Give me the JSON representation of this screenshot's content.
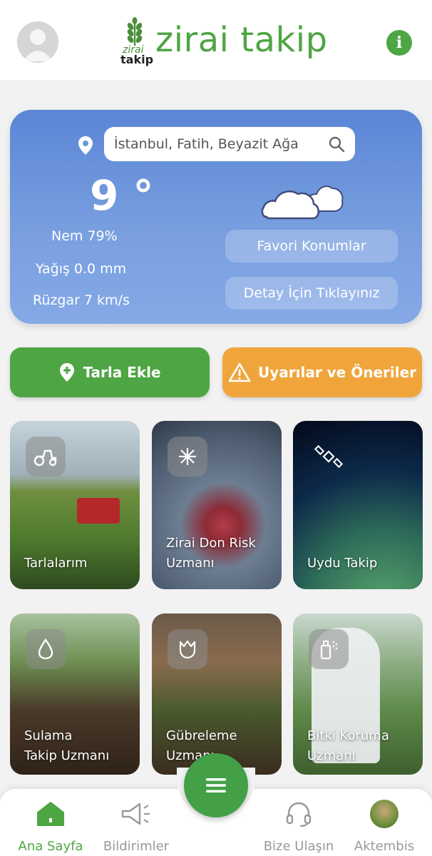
{
  "header": {
    "logo_small_top": "zirai",
    "logo_small_bottom": "takip",
    "logo_text": "zirai takip",
    "info_label": "i"
  },
  "weather": {
    "search_value": "İstanbul, Fatih, Beyazit Ağa",
    "temperature": "9 °",
    "humidity": "Nem 79%",
    "precipitation": "Yağış 0.0 mm",
    "wind": "Rüzgar 7 km/s",
    "favorites_button": "Favori Konumlar",
    "details_button": "Detay İçin Tıklayınız",
    "condition_icon": "cloud-icon"
  },
  "actions": {
    "add_field": "Tarla Ekle",
    "warnings": "Uyarılar ve Öneriler"
  },
  "tiles": [
    {
      "line1": "Tarlalarım",
      "line2": "",
      "icon": "tractor-icon"
    },
    {
      "line1": "Zirai Don Risk",
      "line2": "Uzmanı",
      "icon": "snowflake-icon"
    },
    {
      "line1": "Uydu Takip",
      "line2": "",
      "icon": "satellite-icon"
    },
    {
      "line1": "Sulama",
      "line2": "Takip Uzmanı",
      "icon": "water-drop-icon"
    },
    {
      "line1": "Gübreleme",
      "line2": "Uzmanı",
      "icon": "tulip-icon"
    },
    {
      "line1": "Bitki Koruma",
      "line2": "Uzmanı",
      "icon": "sprayer-icon"
    }
  ],
  "nav": {
    "home": "Ana Sayfa",
    "notifications": "Bildirimler",
    "contact": "Bize Ulaşın",
    "profile": "Aktembis"
  },
  "colors": {
    "brand_green": "#4ea543",
    "warning_orange": "#f0a53c",
    "weather_blue": "#6a95dc"
  }
}
